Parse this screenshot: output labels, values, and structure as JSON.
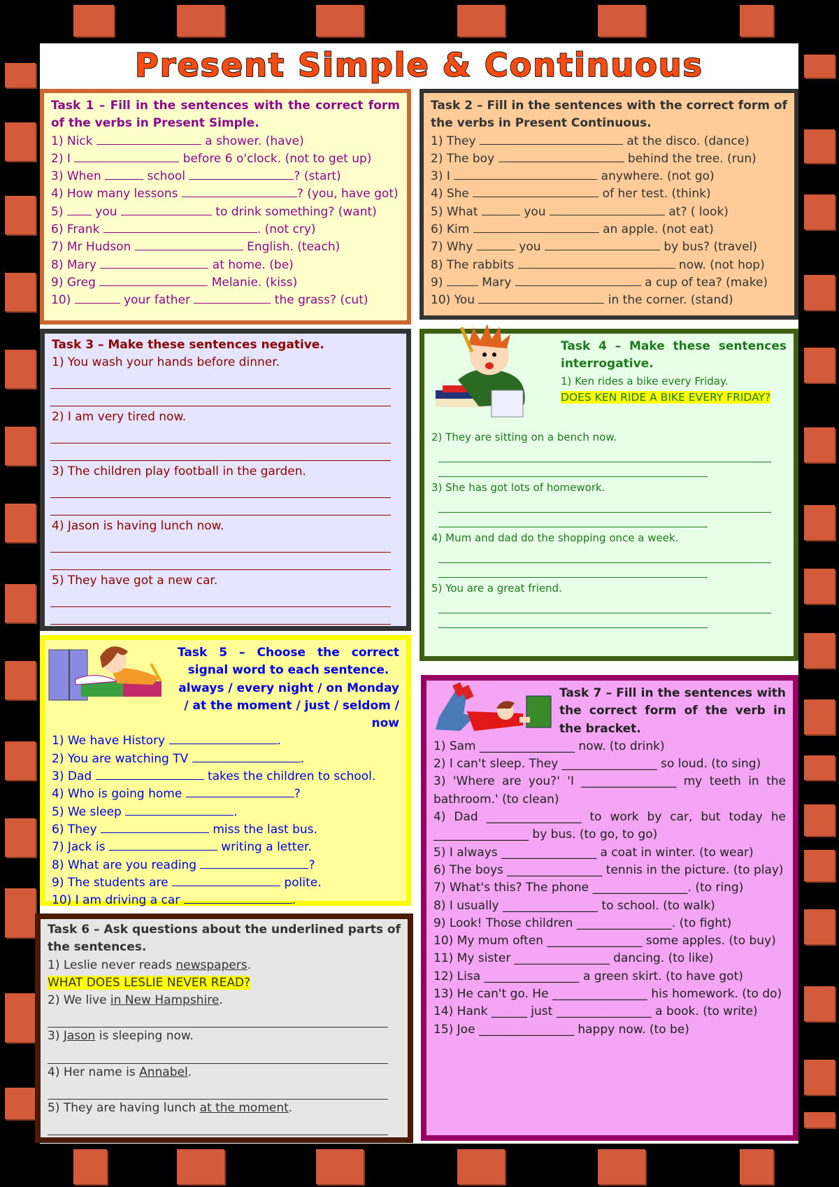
{
  "title": "Present Simple & Continuous",
  "task1": {
    "heading": "Task 1 – Fill in the sentences with the correct form of the verbs in Present Simple.",
    "items": [
      {
        "pre": "1) Nick ",
        "b1": 150,
        "post": " a shower. (have)"
      },
      {
        "pre": "2) I ",
        "b1": 150,
        "post": " before 6 o'clock. (not to get up)"
      },
      {
        "pre": "3) When ",
        "b1": 55,
        "mid": " school ",
        "b2": 150,
        "post": "? (start)"
      },
      {
        "pre": "4) How many lessons ",
        "b1": 165,
        "post": "? (you, have got)"
      },
      {
        "pre": "5) ",
        "b1": 35,
        "mid": " you ",
        "b2": 130,
        "post": " to drink something? (want)"
      },
      {
        "pre": "6) Frank ",
        "b1": 220,
        "post": ". (not cry)"
      },
      {
        "pre": "7) Mr Hudson ",
        "b1": 155,
        "post": " English. (teach)"
      },
      {
        "pre": "8) Mary ",
        "b1": 155,
        "post": " at home. (be)"
      },
      {
        "pre": "9) Greg ",
        "b1": 155,
        "post": " Melanie. (kiss)"
      },
      {
        "pre": "10) ",
        "b1": 65,
        "mid": " your father ",
        "b2": 110,
        "post": " the grass? (cut)"
      }
    ]
  },
  "task2": {
    "heading": "Task 2 – Fill in the sentences with the correct form of the verbs in Present Continuous.",
    "items": [
      {
        "pre": "1) They ",
        "b1": 205,
        "post": " at the disco. (dance)"
      },
      {
        "pre": "2) The boy ",
        "b1": 180,
        "post": " behind the tree. (run)"
      },
      {
        "pre": "3) I ",
        "b1": 205,
        "post": " anywhere. (not go)"
      },
      {
        "pre": "4) She ",
        "b1": 180,
        "post": " of her test. (think)"
      },
      {
        "pre": "5) What ",
        "b1": 55,
        "mid": " you ",
        "b2": 165,
        "post": " at? ( look)"
      },
      {
        "pre": "6) Kim ",
        "b1": 180,
        "post": " an apple. (not eat)"
      },
      {
        "pre": "7) Why ",
        "b1": 55,
        "mid": " you ",
        "b2": 165,
        "post": " by bus? (travel)"
      },
      {
        "pre": "8) The rabbits ",
        "b1": 225,
        "post": " now. (not hop)"
      },
      {
        "pre": "9) ",
        "b1": 45,
        "mid": " Mary ",
        "b2": 180,
        "post": " a cup of tea? (make)"
      },
      {
        "pre": "10) You ",
        "b1": 180,
        "post": " in the corner. (stand)"
      }
    ]
  },
  "task3": {
    "heading": "Task 3 – Make these sentences negative.",
    "items": [
      "1) You wash your hands before dinner.",
      "2) I am very tired now.",
      "3) The children play football in the garden.",
      "4) Jason is having lunch now.",
      "5) They have got a new car."
    ]
  },
  "task4": {
    "heading": "Task 4 – Make these sentences interrogative.",
    "example": "1) Ken rides a bike every Friday.",
    "example_answer": "DOES KEN RIDE A BIKE EVERY FRIDAY?",
    "items": [
      "2) They are sitting on a bench now.",
      "3) She has got lots of homework.",
      "4) Mum and dad do the shopping once a week.",
      "5) You are a great friend."
    ],
    "image_label": "boy thinking with books"
  },
  "task5": {
    "heading": "Task 5 – Choose the correct signal word to each sentence.",
    "words": "always / every night / on Monday / at the moment / just / seldom / now",
    "items": [
      {
        "pre": "1) We have History ",
        "b1": 155,
        "post": "."
      },
      {
        "pre": "2) You are watching TV ",
        "b1": 155,
        "post": "."
      },
      {
        "pre": "3) Dad ",
        "b1": 155,
        "post": " takes the children to school."
      },
      {
        "pre": "4) Who is going home ",
        "b1": 155,
        "post": "?"
      },
      {
        "pre": "5) We sleep ",
        "b1": 155,
        "post": "."
      },
      {
        "pre": "6) They ",
        "b1": 155,
        "post": " miss the last bus."
      },
      {
        "pre": "7) Jack is ",
        "b1": 155,
        "post": " writing a letter."
      },
      {
        "pre": "8) What are you reading ",
        "b1": 155,
        "post": "?"
      },
      {
        "pre": "9) The students are ",
        "b1": 155,
        "post": " polite."
      },
      {
        "pre": "10) I am driving a car ",
        "b1": 155,
        "post": "."
      }
    ]
  },
  "task6": {
    "heading": "Task 6 – Ask questions about the underlined parts of the sentences.",
    "example": {
      "pre": "1) Leslie never reads ",
      "u": "newspapers",
      "post": "."
    },
    "example_answer": "WHAT DOES LESLIE NEVER READ?",
    "items": [
      {
        "pre": "2) We live ",
        "u": "in New Hampshire",
        "post": "."
      },
      {
        "pre": "3) ",
        "u": "Jason",
        "post": " is sleeping now."
      },
      {
        "pre": "4) Her name is ",
        "u": "Annabel",
        "post": "."
      },
      {
        "pre": "5) They are having lunch ",
        "u": "at the moment",
        "post": "."
      }
    ]
  },
  "task7": {
    "heading": "Task 7 – Fill in the sentences with the correct form of the verb in the bracket.",
    "items": [
      "1) Sam ________________ now. (to drink)",
      "2) I can't sleep. They ________________ so loud. (to sing)",
      "3) 'Where are you?' 'I ________________ my teeth in the bathroom.' (to clean)",
      "4) Dad ________________ to work by car, but today he ________________ by bus. (to go, to go)",
      "5) I always ________________ a coat in winter. (to wear)",
      "6) The boys ________________ tennis in the picture. (to play)",
      "7) What's this? The phone ________________. (to ring)",
      "8) I usually ________________ to school. (to walk)",
      "9) Look! Those children ________________. (to fight)",
      "10) My mum often ________________ some apples. (to buy)",
      "11) My sister ________________ dancing. (to like)",
      "12) Lisa ________________ a green skirt. (to have got)",
      "13) He can't go. He ________________ his homework. (to do)",
      "14) Hank ______ just ________________ a book. (to write)",
      "15) Joe ________________ happy now. (to be)"
    ],
    "image_label": "boy lying reading a book"
  }
}
